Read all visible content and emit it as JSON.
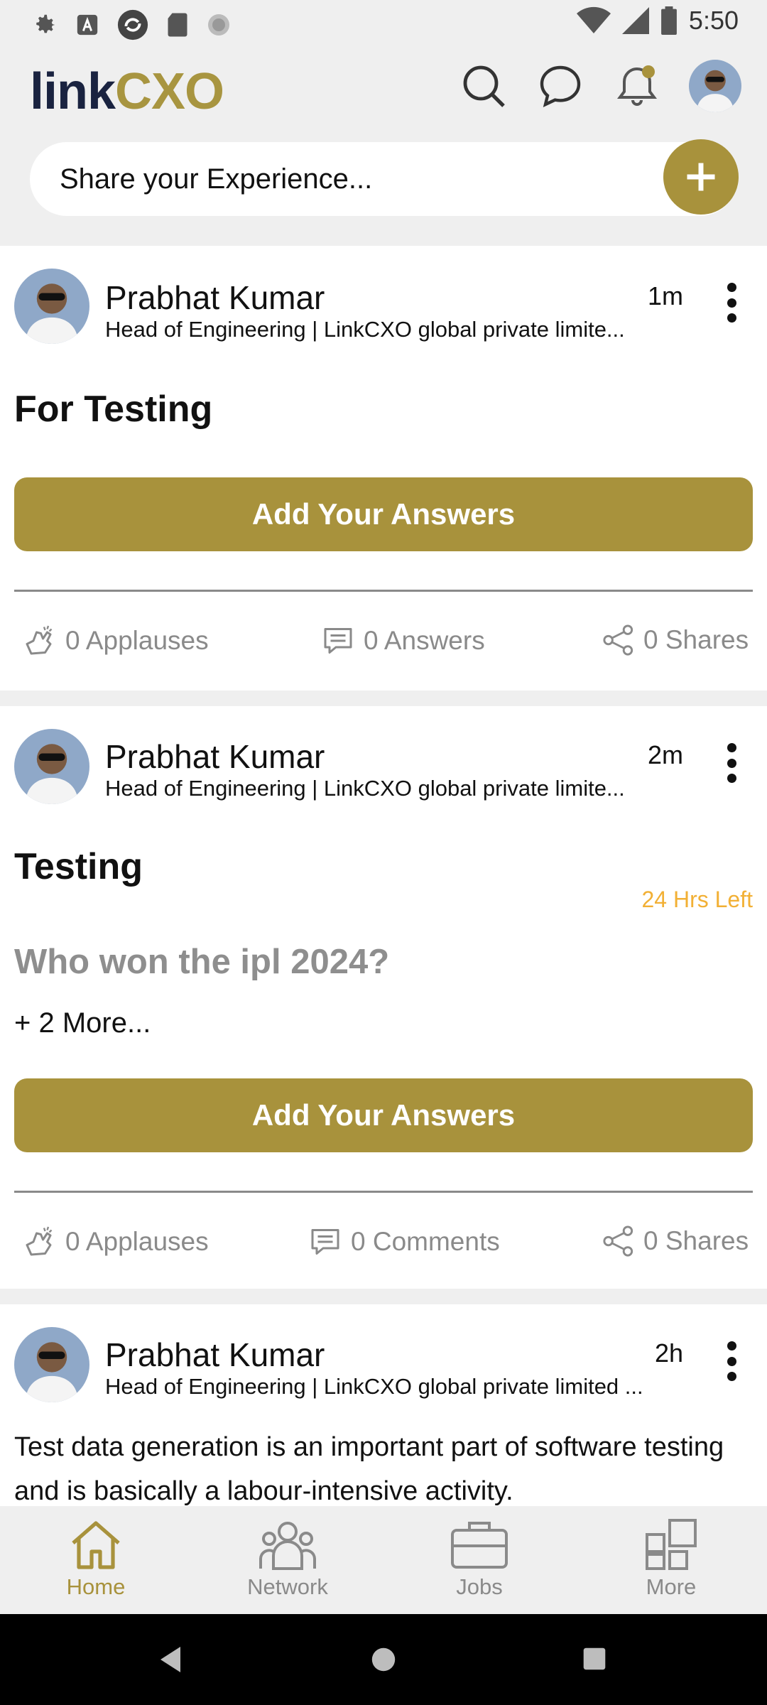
{
  "status": {
    "time": "5:50"
  },
  "header": {
    "logo_part1": "link",
    "logo_part2": "CXO",
    "share_placeholder": "Share your Experience..."
  },
  "posts": [
    {
      "author": "Prabhat Kumar",
      "subtitle": "Head of Engineering | LinkCXO global private limite...",
      "time": "1m",
      "title": "For Testing",
      "button": "Add Your Answers",
      "applauses": "0 Applauses",
      "answers": "0 Answers",
      "shares": "0 Shares"
    },
    {
      "author": "Prabhat Kumar",
      "subtitle": "Head of Engineering | LinkCXO global private limite...",
      "time": "2m",
      "title": "Testing",
      "time_left": "24 Hrs Left",
      "question": "Who won the ipl 2024?",
      "more": "+ 2 More...",
      "button": "Add Your Answers",
      "applauses": "0 Applauses",
      "comments": "0 Comments",
      "shares": "0 Shares"
    },
    {
      "author": "Prabhat Kumar",
      "subtitle": "Head of Engineering | LinkCXO global private limited ...",
      "time": "2h",
      "body": "Test data generation is an important part of software testing and is basically a labour-intensive activity."
    }
  ],
  "nav": {
    "home": "Home",
    "network": "Network",
    "jobs": "Jobs",
    "more": "More"
  },
  "colors": {
    "accent": "#a8923c",
    "time_left": "#f2b035",
    "background": "#efefef"
  }
}
